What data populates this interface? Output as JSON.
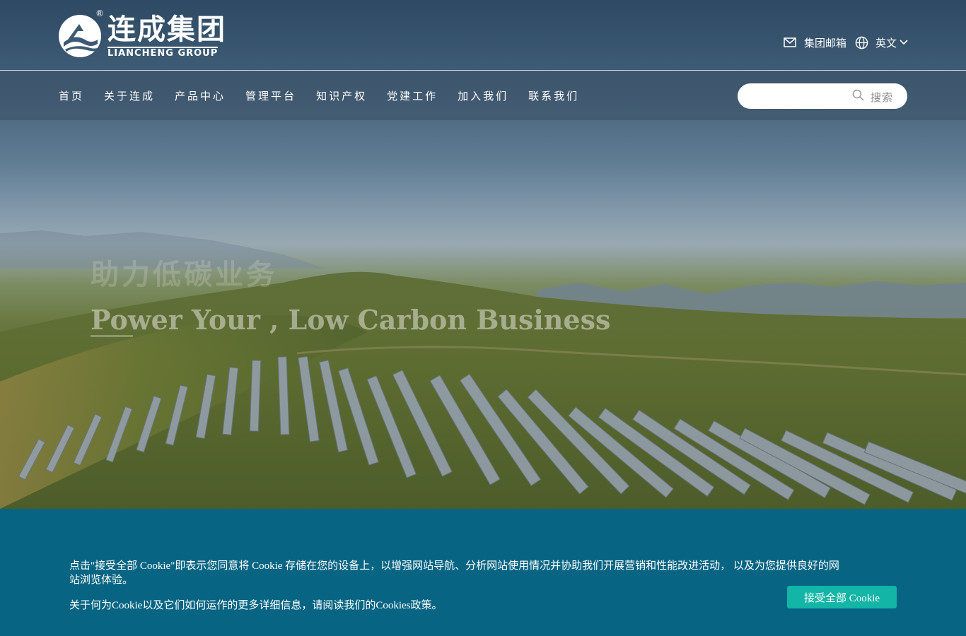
{
  "brand": {
    "name_cn": "连成集团",
    "name_en": "LIANCHENG GROUP",
    "reg_mark": "®"
  },
  "top_links": {
    "mail_label": "集团邮箱",
    "mail_icon": "mail-icon",
    "language_label": "英文",
    "language_icon": "globe-icon",
    "dropdown_icon": "chevron-down-icon"
  },
  "nav": {
    "items": [
      "首页",
      "关于连成",
      "产品中心",
      "管理平台",
      "知识产权",
      "党建工作",
      "加入我们",
      "联系我们"
    ]
  },
  "search": {
    "label": "搜索",
    "icon": "search-icon"
  },
  "hero": {
    "title_cn": "助力低碳业务",
    "title_en": "Power Your , Low Carbon Business"
  },
  "cookie_banner": {
    "message": "点击\"接受全部 Cookie\"即表示您同意将 Cookie 存储在您的设备上，以增强网站导航、分析网站使用情况并协助我们开展营销和性能改进活动， 以及为您提供良好的网站浏览体验。",
    "more_info": "关于何为Cookie以及它们如何运作的更多详细信息，请阅读我们的Cookies政策。",
    "accept_label": "接受全部 Cookie"
  },
  "colors": {
    "banner_bg": "#076583",
    "accept_button": "#12b5a6",
    "nav_bar": "#3a5064"
  }
}
